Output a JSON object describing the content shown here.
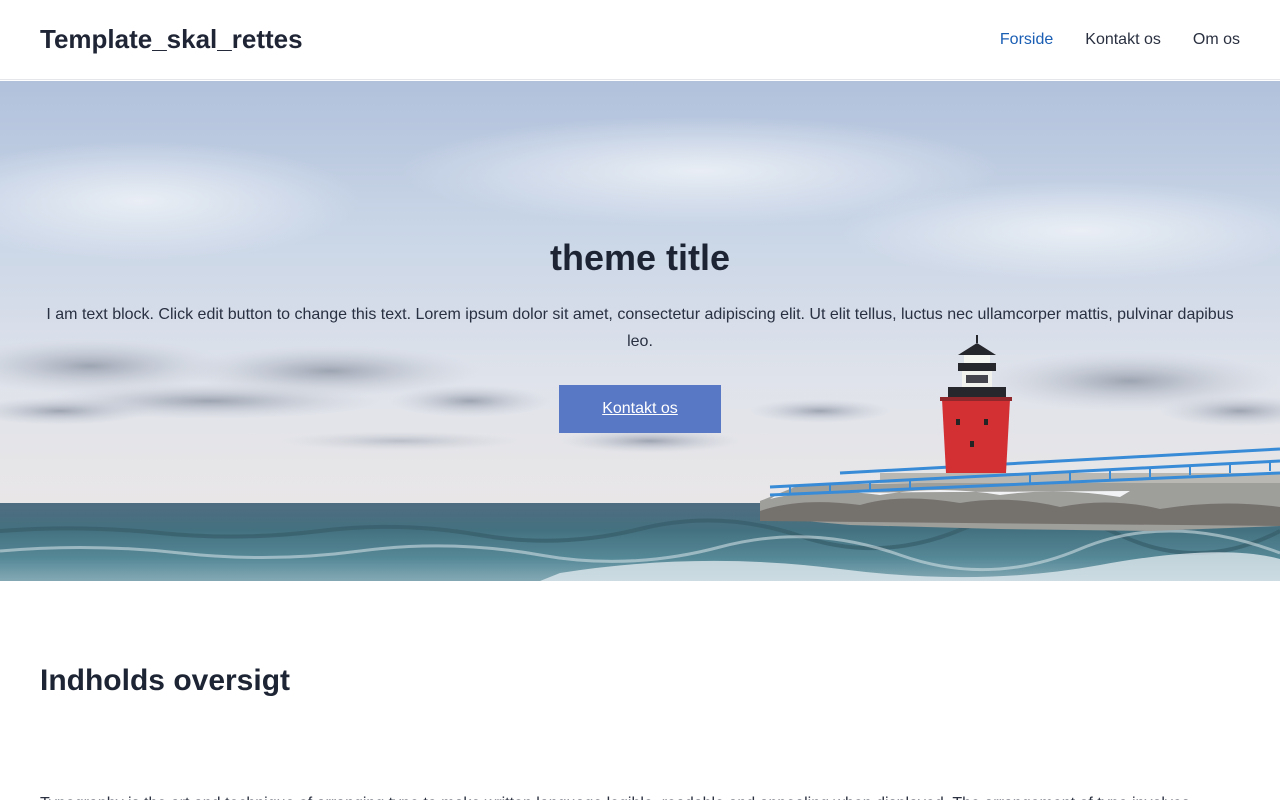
{
  "site": {
    "title": "Template_skal_rettes"
  },
  "nav": {
    "items": [
      {
        "label": "Forside",
        "active": true
      },
      {
        "label": "Kontakt os",
        "active": false
      },
      {
        "label": "Om os",
        "active": false
      }
    ]
  },
  "hero": {
    "title": "theme title",
    "text": "I am text block. Click edit button to change this text. Lorem ipsum dolor sit amet, consectetur adipiscing elit. Ut elit tellus, luctus nec ullamcorper mattis, pulvinar dapibus leo.",
    "button_label": "Kontakt os",
    "background_image": "lighthouse-pier-seascape"
  },
  "content": {
    "title": "Indholds oversigt",
    "body": "Typography is the art and technique of arranging type to make written language legible, readable and appealing when displayed. The arrangement of type involves"
  },
  "colors": {
    "accent": "#5877c4",
    "nav_active": "#1a5eb4",
    "text_dark": "#1d2534"
  }
}
